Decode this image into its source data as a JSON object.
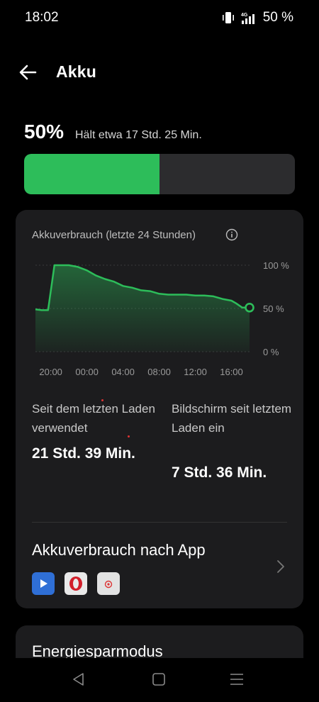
{
  "status_bar": {
    "time": "18:02",
    "network": "4G",
    "battery": "50 %"
  },
  "header": {
    "title": "Akku",
    "back_icon": "arrow-left-icon"
  },
  "battery": {
    "percent": "50%",
    "estimate": "Hält etwa 17 Std. 25 Min.",
    "level": 0.5,
    "fill_color": "#2dbd5a"
  },
  "usage_card": {
    "chart_title": "Akkuverbrauch (letzte 24 Stunden)",
    "info_icon": "info-icon",
    "stat1": {
      "label": "Seit dem letzten Laden verwendet",
      "value": "21 Std. 39 Min."
    },
    "stat2": {
      "label": "Bildschirm seit letztem Laden ein",
      "value": "7 Std. 36 Min."
    },
    "app_usage": {
      "label": "Akkuverbrauch nach App",
      "apps": [
        "video-player-icon",
        "opera-icon",
        "app-icon"
      ]
    }
  },
  "power_saving_card": {
    "title": "Energiesparmodus"
  },
  "chart_data": {
    "type": "area",
    "x_tick_labels": [
      "20:00",
      "00:00",
      "04:00",
      "08:00",
      "12:00",
      "16:00"
    ],
    "y_tick_labels": [
      "100 %",
      "50 %",
      "0 %"
    ],
    "ylim": [
      0,
      100
    ],
    "xlim": [
      18.3,
      42.0
    ],
    "x_tick_values": [
      20,
      24,
      28,
      32,
      36,
      40
    ],
    "x": [
      18.3,
      19.0,
      19.7,
      20.4,
      21.2,
      22.0,
      23.0,
      24.0,
      25.0,
      26.0,
      27.0,
      28.0,
      29.0,
      30.0,
      31.0,
      32.0,
      33.0,
      34.0,
      35.0,
      36.0,
      37.0,
      38.0,
      39.0,
      40.0,
      40.5,
      41.2,
      42.0
    ],
    "values": [
      49,
      48,
      48,
      100,
      100,
      100,
      98,
      94,
      88,
      84,
      81,
      76,
      74,
      71,
      70,
      67,
      66,
      66,
      66,
      65,
      65,
      64,
      61,
      59,
      56,
      51,
      51
    ],
    "line_color": "#2dbd5a",
    "grid": true
  }
}
